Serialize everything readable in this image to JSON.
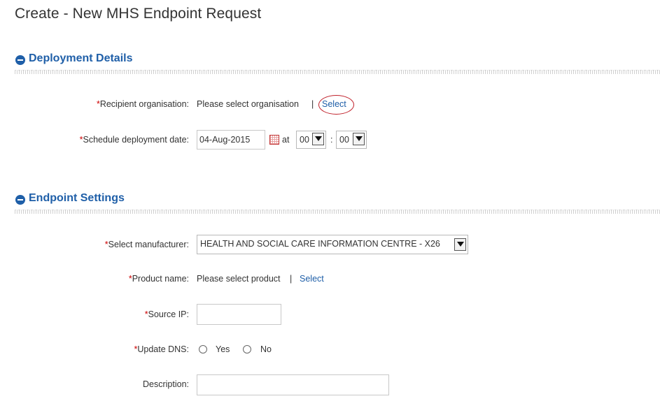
{
  "page": {
    "title": "Create - New MHS Endpoint Request"
  },
  "deployment": {
    "heading": "Deployment Details",
    "recipient": {
      "required": "*",
      "label": "Recipient organisation:",
      "value": "Please select organisation",
      "separator": "|",
      "link": "Select"
    },
    "schedule": {
      "required": "*",
      "label": "Schedule deployment date:",
      "date": "04-Aug-2015",
      "at": "at",
      "hour": "00",
      "colon": ":",
      "minute": "00"
    }
  },
  "endpoint": {
    "heading": "Endpoint Settings",
    "manufacturer": {
      "required": "*",
      "label": "Select manufacturer:",
      "value": "HEALTH AND SOCIAL CARE INFORMATION CENTRE - X26"
    },
    "product": {
      "required": "*",
      "label": "Product name:",
      "value": "Please select product",
      "separator": "|",
      "link": "Select"
    },
    "source_ip": {
      "required": "*",
      "label": "Source IP:",
      "value": ""
    },
    "update_dns": {
      "required": "*",
      "label": "Update DNS:",
      "yes": "Yes",
      "no": "No"
    },
    "description": {
      "label": "Description:",
      "value": ""
    }
  },
  "colors": {
    "accent": "#1f5fa8",
    "required": "#cc0000",
    "highlight_circle": "#c0202a"
  }
}
